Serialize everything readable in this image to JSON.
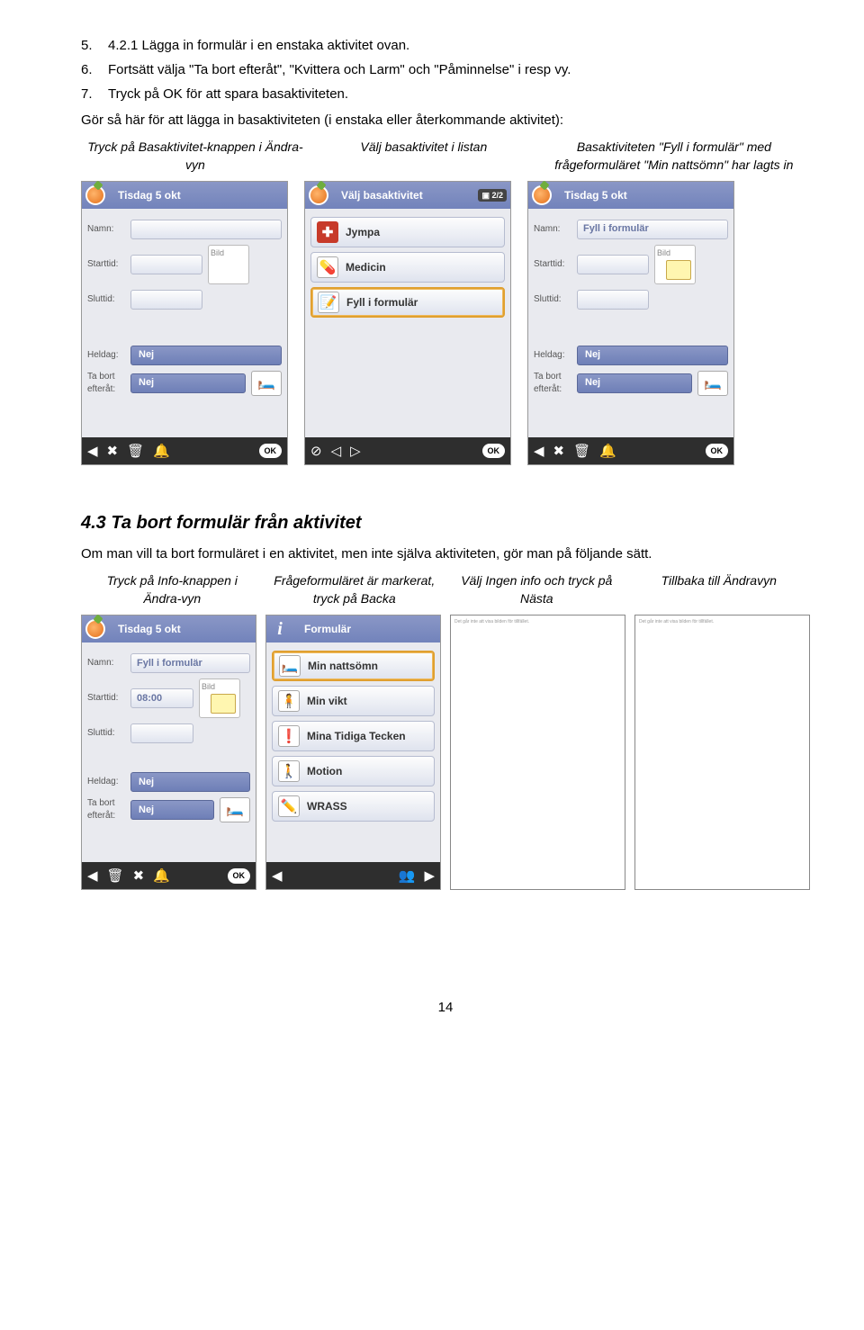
{
  "list": {
    "n5": "5.",
    "t5": "4.2.1 Lägga in formulär i en enstaka aktivitet ovan.",
    "n6": "6.",
    "t6": "Fortsätt välja \"Ta bort efteråt\", \"Kvittera och Larm\" och \"Påminnelse\" i resp vy.",
    "n7": "7.",
    "t7": "Tryck på OK för att spara basaktiviteten."
  },
  "intro1": "Gör så här för att lägga in basaktiviteten (i enstaka eller återkommande aktivitet):",
  "caps1": {
    "c1": "Tryck på Basaktivitet-knappen i Ändra-vyn",
    "c2": "Välj basaktivitet i listan",
    "c3": "Basaktiviteten \"Fyll i formulär\" med frågeformuläret \"Min nattsömn\" har lagts in"
  },
  "phone1": {
    "title": "Tisdag 5 okt",
    "namn": "Namn:",
    "starttid": "Starttid:",
    "sluttid": "Sluttid:",
    "heldag": "Heldag:",
    "tabort": "Ta bort\nefteråt:",
    "nej": "Nej",
    "bild": "Bild",
    "ok": "OK"
  },
  "phone2": {
    "title": "Välj basaktivitet",
    "pill": "▣ 2/2",
    "i1": "Jympa",
    "i2": "Medicin",
    "i3": "Fyll i formulär",
    "ok": "OK"
  },
  "phone3": {
    "title": "Tisdag 5 okt",
    "namn_val": "Fyll i formulär"
  },
  "sec43": "4.3 Ta bort formulär från aktivitet",
  "para43": "Om man vill ta bort formuläret i en aktivitet, men inte själva aktiviteten, gör man på följande sätt.",
  "caps2": {
    "c1": "Tryck på Info-knappen i Ändra-vyn",
    "c2": "Frågeformuläret är markerat, tryck på Backa",
    "c3": "Välj Ingen info och tryck på Nästa",
    "c4": "Tillbaka till Ändravyn"
  },
  "phone4": {
    "title": "Tisdag 5 okt",
    "namn_val": "Fyll i formulär",
    "starttid_val": "08:00"
  },
  "phone5": {
    "title": "Formulär",
    "i1": "Min nattsömn",
    "i2": "Min vikt",
    "i3": "Mina Tidiga Tecken",
    "i4": "Motion",
    "i5": "WRASS"
  },
  "placeholder_text": "Det går inte att visa bilden för tillfället.",
  "pagenum": "14"
}
